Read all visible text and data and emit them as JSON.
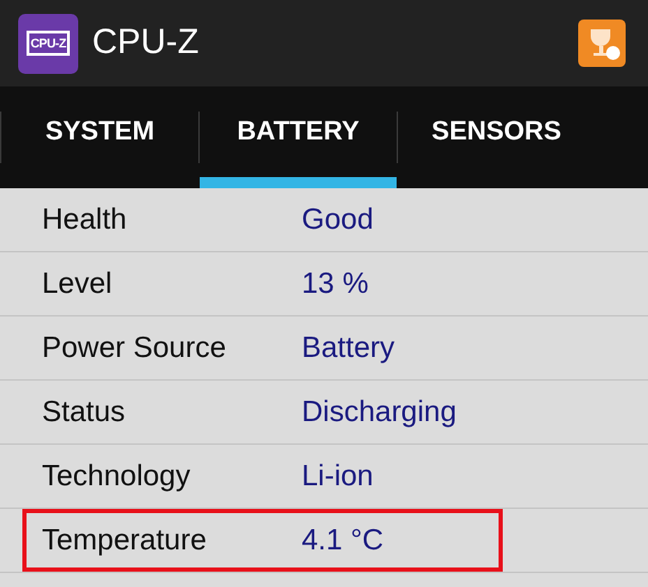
{
  "app_bar": {
    "logo_text": "CPU-Z",
    "title": "CPU-Z"
  },
  "tabs": [
    {
      "label": "SYSTEM",
      "selected": false
    },
    {
      "label": "BATTERY",
      "selected": true
    },
    {
      "label": "SENSORS",
      "selected": false
    }
  ],
  "rows": [
    {
      "label": "Health",
      "value": "Good",
      "highlighted": false
    },
    {
      "label": "Level",
      "value": "13 %",
      "highlighted": false
    },
    {
      "label": "Power Source",
      "value": "Battery",
      "highlighted": false
    },
    {
      "label": "Status",
      "value": "Discharging",
      "highlighted": false
    },
    {
      "label": "Technology",
      "value": "Li-ion",
      "highlighted": false
    },
    {
      "label": "Temperature",
      "value": "4.1 °C",
      "highlighted": true
    }
  ]
}
